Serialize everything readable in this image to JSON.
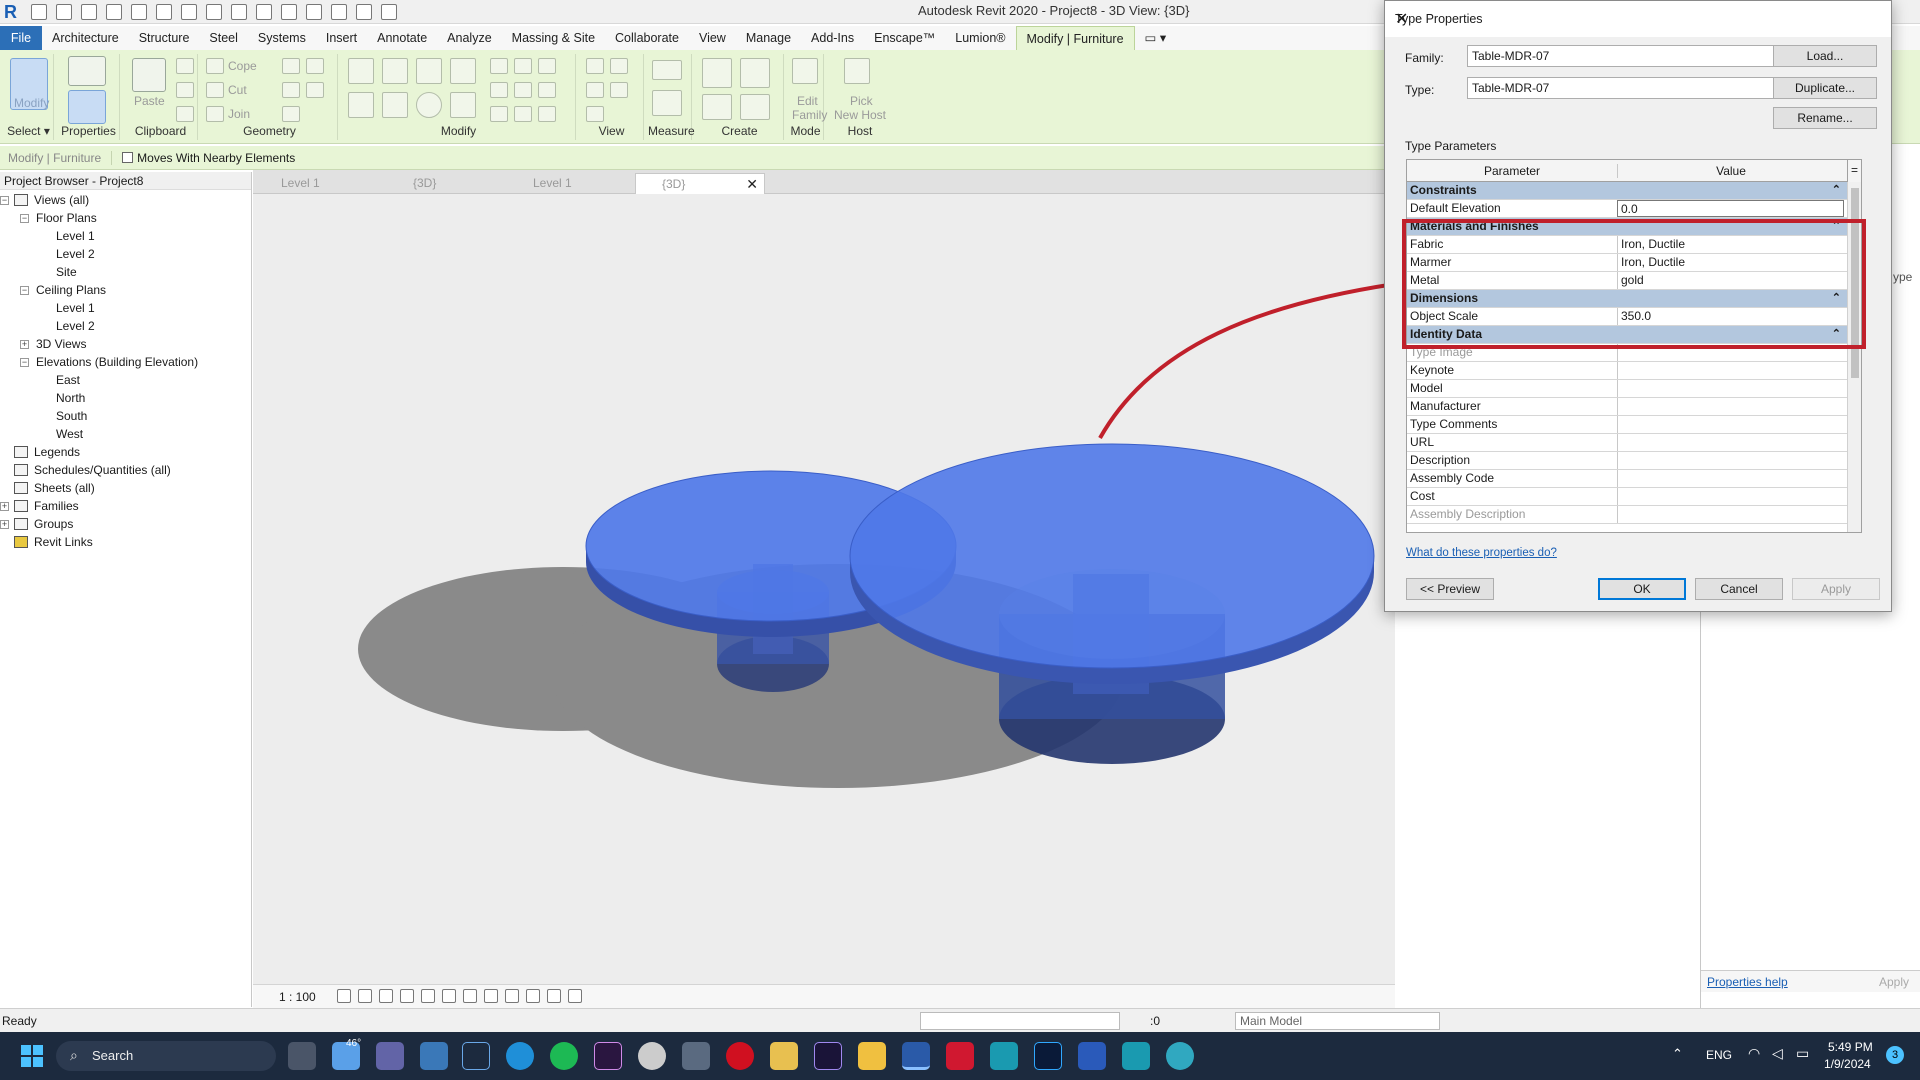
{
  "window": {
    "title": "Autodesk Revit 2020 - Project8 - 3D View: {3D}"
  },
  "ribbon_tabs": [
    "File",
    "Architecture",
    "Structure",
    "Steel",
    "Systems",
    "Insert",
    "Annotate",
    "Analyze",
    "Massing & Site",
    "Collaborate",
    "View",
    "Manage",
    "Add-Ins",
    "Enscape™",
    "Lumion®",
    "Modify | Furniture"
  ],
  "ribbon": {
    "groups": {
      "select": "Select",
      "properties": "Properties",
      "clipboard": "Clipboard",
      "geometry": "Geometry",
      "modify": "Modify",
      "view": "View",
      "measure": "Measure",
      "create": "Create",
      "mode": "Mode",
      "host": "Host"
    },
    "modify_label": "Modify",
    "paste_label": "Paste",
    "cope_label": "Cope",
    "cut_label": "Cut",
    "join_label": "Join",
    "edit_family_1": "Edit",
    "edit_family_2": "Family",
    "pick_host_1": "Pick",
    "pick_host_2": "New Host"
  },
  "options_bar": {
    "context": "Modify | Furniture",
    "moves_with_nearby": "Moves With Nearby Elements",
    "moves_with_nearby_checked": false
  },
  "project_browser": {
    "title": "Project Browser - Project8",
    "items": [
      {
        "label": "Views (all)",
        "level": 0,
        "exp": "-"
      },
      {
        "label": "Floor Plans",
        "level": 1,
        "exp": "-"
      },
      {
        "label": "Level 1",
        "level": 2
      },
      {
        "label": "Level 2",
        "level": 2
      },
      {
        "label": "Site",
        "level": 2
      },
      {
        "label": "Ceiling Plans",
        "level": 1,
        "exp": "-"
      },
      {
        "label": "Level 1",
        "level": 2
      },
      {
        "label": "Level 2",
        "level": 2
      },
      {
        "label": "3D Views",
        "level": 1,
        "exp": "+"
      },
      {
        "label": "Elevations (Building Elevation)",
        "level": 1,
        "exp": "-"
      },
      {
        "label": "East",
        "level": 2
      },
      {
        "label": "North",
        "level": 2
      },
      {
        "label": "South",
        "level": 2
      },
      {
        "label": "West",
        "level": 2
      },
      {
        "label": "Legends",
        "level": 0
      },
      {
        "label": "Schedules/Quantities (all)",
        "level": 0
      },
      {
        "label": "Sheets (all)",
        "level": 0
      },
      {
        "label": "Families",
        "level": 0,
        "exp": "+"
      },
      {
        "label": "Groups",
        "level": 0,
        "exp": "+"
      },
      {
        "label": "Revit Links",
        "level": 0
      }
    ]
  },
  "view_tabs": [
    "Level 1",
    "{3D}",
    "Level 1",
    "{3D}"
  ],
  "view_bar": {
    "scale": "1 : 100"
  },
  "status_bar": {
    "status": "Ready",
    "worksets": ":0",
    "model": "Main Model"
  },
  "right_panel": {
    "help_link": "Properties help",
    "apply": "Apply",
    "type_label": "ype"
  },
  "dialog": {
    "title": "Type Properties",
    "family_label": "Family:",
    "family_value": "Table-MDR-07",
    "type_label": "Type:",
    "type_value": "Table-MDR-07",
    "load_button": "Load...",
    "duplicate_button": "Duplicate...",
    "rename_button": "Rename...",
    "type_parameters_label": "Type Parameters",
    "col_parameter": "Parameter",
    "col_value": "Value",
    "col_eq": "=",
    "rows": [
      {
        "group": "Constraints"
      },
      {
        "name": "Default Elevation",
        "value": "0.0"
      },
      {
        "group": "Materials and Finishes"
      },
      {
        "name": "Fabric",
        "value": "Iron, Ductile"
      },
      {
        "name": "Marmer",
        "value": "Iron, Ductile"
      },
      {
        "name": "Metal",
        "value": "gold"
      },
      {
        "group": "Dimensions"
      },
      {
        "name": "Object Scale",
        "value": "350.0"
      },
      {
        "group": "Identity Data"
      },
      {
        "name": "Type Image",
        "value": "",
        "greyed": true
      },
      {
        "name": "Keynote",
        "value": ""
      },
      {
        "name": "Model",
        "value": ""
      },
      {
        "name": "Manufacturer",
        "value": ""
      },
      {
        "name": "Type Comments",
        "value": ""
      },
      {
        "name": "URL",
        "value": ""
      },
      {
        "name": "Description",
        "value": ""
      },
      {
        "name": "Assembly Code",
        "value": ""
      },
      {
        "name": "Cost",
        "value": ""
      },
      {
        "name": "Assembly Description",
        "value": "",
        "greyed": true
      }
    ],
    "help_link": "What do these properties do?",
    "preview_button": "<< Preview",
    "ok_button": "OK",
    "cancel_button": "Cancel",
    "apply_button": "Apply"
  },
  "taskbar": {
    "search": "Search",
    "temp": "46°",
    "lang": "ENG",
    "time": "5:49 PM",
    "date": "1/9/2024",
    "notif": "3"
  },
  "colors": {
    "ribbon_bg": "#e8f5d6",
    "highlight": "#c0202b",
    "table_blue": "#4a72e0",
    "group_header": "#b3c7de",
    "file_tab": "#2c6fb7",
    "taskbar": "#1c2a3e"
  }
}
